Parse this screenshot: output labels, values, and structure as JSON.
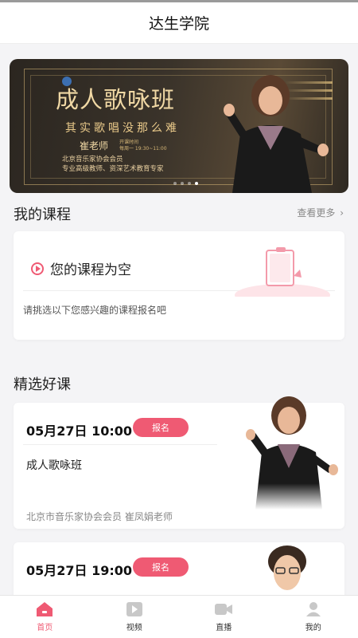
{
  "app": {
    "title": "达生学院"
  },
  "banner": {
    "title": "成人歌咏班",
    "subtitle": "其实歌唱没那么难",
    "teacher": "崔老师",
    "schedule_label": "开课时间",
    "schedule": "每周一  19:30~11:00",
    "desc_line1": "北京音乐家协会会员",
    "desc_line2": "专业高级教师、资深艺术教育专家",
    "slide_count": 4,
    "active_slide": 4
  },
  "my_courses": {
    "title": "我的课程",
    "more": "查看更多",
    "empty_title": "您的课程为空",
    "empty_hint": "请挑选以下您感兴趣的课程报名吧"
  },
  "featured": {
    "title": "精选好课",
    "courses": [
      {
        "date": "05月27日 10:00",
        "signup": "报名",
        "name": "成人歌咏班",
        "org": "北京市音乐家协会会员 崔凤娟老师"
      },
      {
        "date": "05月27日 19:00",
        "signup": "报名"
      }
    ]
  },
  "tabbar": {
    "items": [
      {
        "label": "首页",
        "icon": "home-icon",
        "active": true
      },
      {
        "label": "视频",
        "icon": "video-icon",
        "active": false
      },
      {
        "label": "直播",
        "icon": "live-camera-icon",
        "active": false
      },
      {
        "label": "我的",
        "icon": "user-icon",
        "active": false
      }
    ]
  },
  "colors": {
    "accent": "#ef5a73",
    "banner_gold": "#f1d9a5"
  }
}
